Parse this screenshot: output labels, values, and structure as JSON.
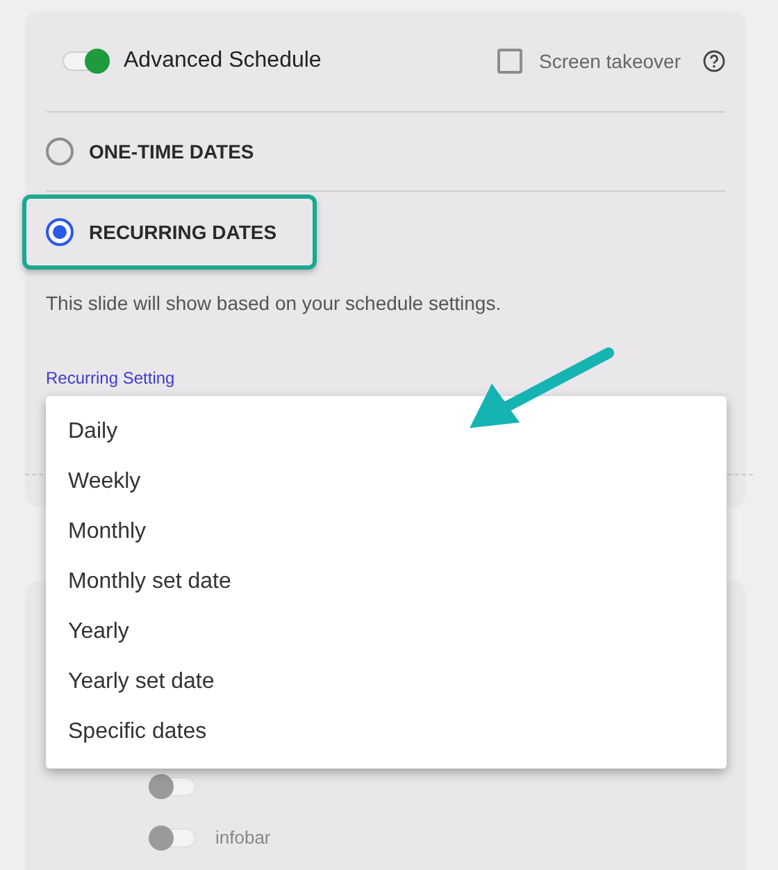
{
  "advanced_schedule": {
    "label": "Advanced Schedule",
    "on": true
  },
  "screen_takeover": {
    "label": "Screen takeover",
    "checked": false
  },
  "date_modes": [
    {
      "label": "ONE-TIME DATES",
      "selected": false
    },
    {
      "label": "RECURRING DATES",
      "selected": true
    }
  ],
  "description": "This slide will show based on your schedule settings.",
  "recurring_setting": {
    "label": "Recurring Setting",
    "options": [
      "Daily",
      "Weekly",
      "Monthly",
      "Monthly set date",
      "Yearly",
      "Yearly set date",
      "Specific dates"
    ]
  },
  "lower_toggles": [
    {
      "on": false
    },
    {
      "label": "infobar",
      "on": false
    }
  ]
}
